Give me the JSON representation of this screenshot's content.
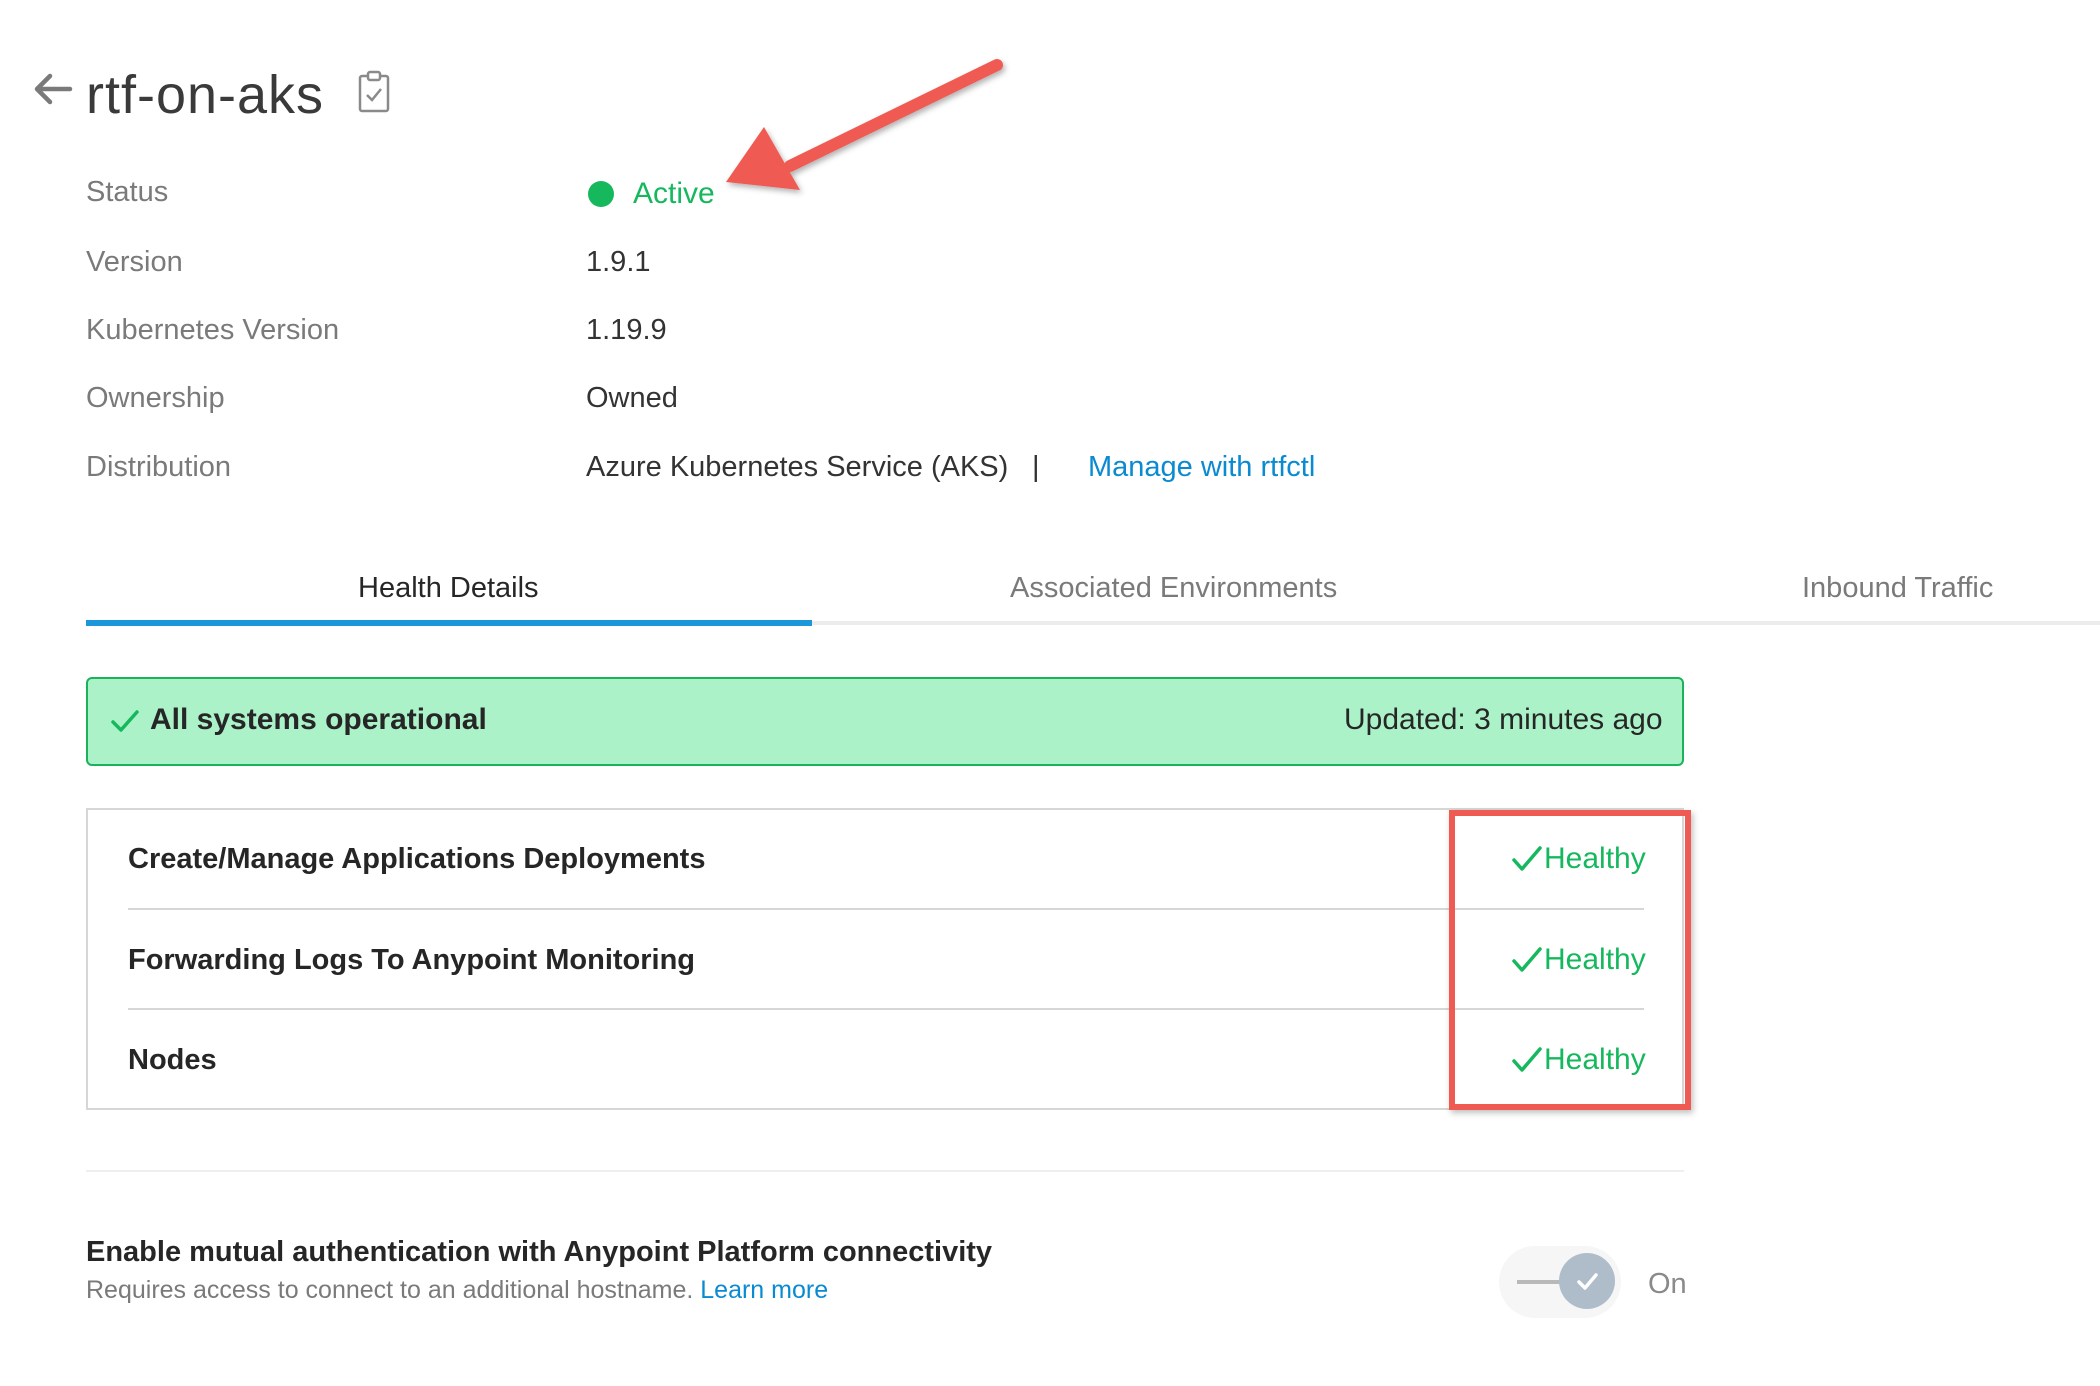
{
  "header": {
    "title": "rtf-on-aks"
  },
  "details": [
    {
      "label": "Status",
      "value": "Active"
    },
    {
      "label": "Version",
      "value": "1.9.1"
    },
    {
      "label": "Kubernetes Version",
      "value": "1.19.9"
    },
    {
      "label": "Ownership",
      "value": "Owned"
    },
    {
      "label": "Distribution",
      "value": "Azure Kubernetes Service (AKS)",
      "separator": "|",
      "link": "Manage with rtfctl"
    }
  ],
  "tabs": [
    {
      "label": "Health Details",
      "active": true
    },
    {
      "label": "Associated Environments",
      "active": false
    },
    {
      "label": "Inbound Traffic",
      "active": false
    }
  ],
  "banner": {
    "text": "All systems operational",
    "updated": "Updated:  3 minutes ago"
  },
  "health_rows": [
    {
      "label": "Create/Manage Applications Deployments",
      "status": "Healthy"
    },
    {
      "label": "Forwarding Logs To Anypoint Monitoring",
      "status": "Healthy"
    },
    {
      "label": "Nodes",
      "status": "Healthy"
    }
  ],
  "mtls": {
    "title": "Enable mutual authentication with Anypoint Platform connectivity",
    "subtitle": "Requires access to connect to an additional hostname.",
    "learn_more": "Learn more",
    "toggle_label": "On",
    "toggle_on": true
  },
  "colors": {
    "status_green": "#16b85e",
    "link_blue": "#0a8ad1",
    "banner_bg": "#abf2c9",
    "tab_accent": "#1c97d9",
    "annotation_red": "#ef5a52"
  },
  "icons": [
    "back-arrow-icon",
    "clipboard-icon",
    "check-icon",
    "annotation-arrow"
  ]
}
